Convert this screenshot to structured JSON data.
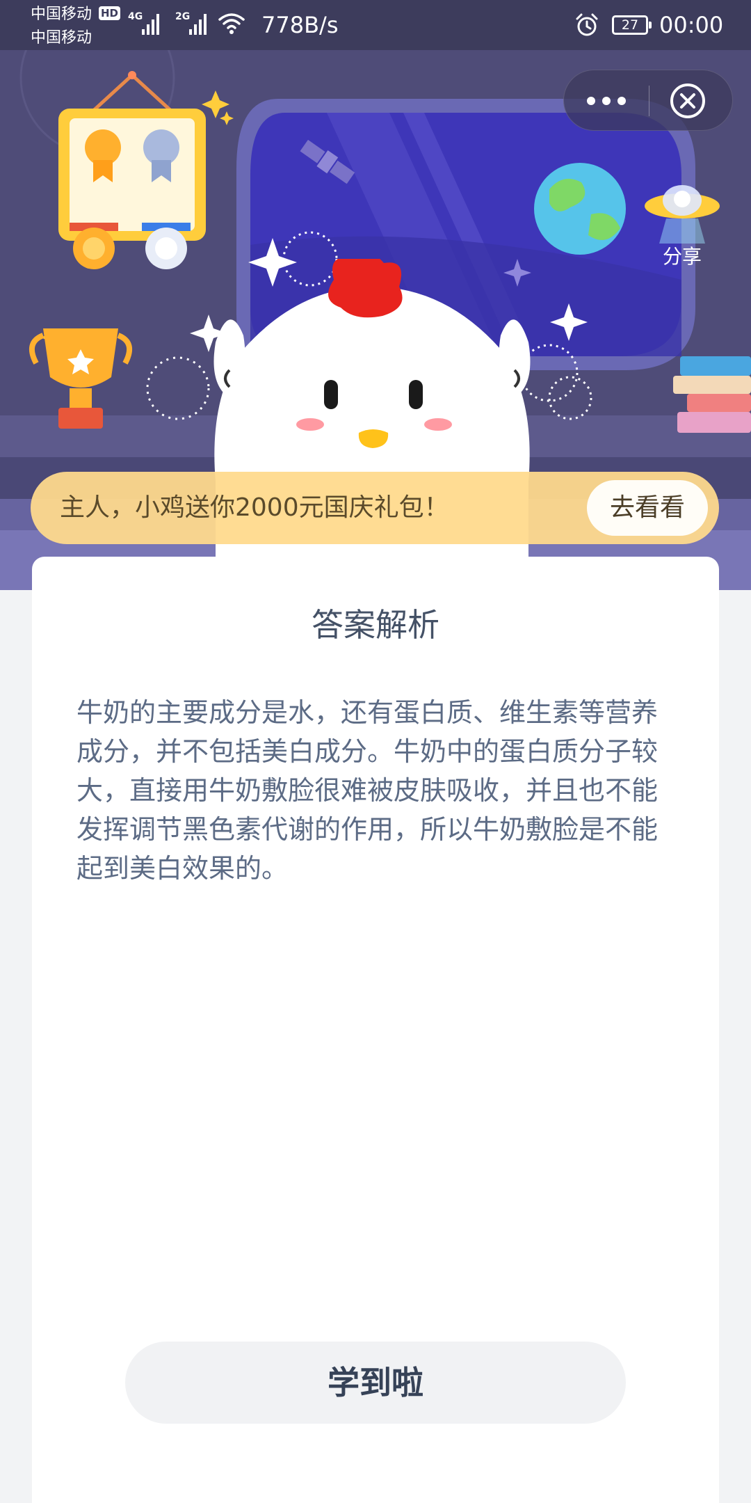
{
  "status_bar": {
    "carrier_primary": "中国移动",
    "hd_badge": "HD",
    "carrier_secondary": "中国移动",
    "network_1": "4G",
    "network_2": "2G",
    "speed": "778B/s",
    "battery": "27",
    "time": "00:00"
  },
  "capsule": {
    "more_icon": "more-dots-icon",
    "close_icon": "close-circle-icon"
  },
  "hero": {
    "share_label": "分享",
    "colors": {
      "sky": "#4f4c78",
      "window": "#3e36b8",
      "banner": "#ffd98c"
    }
  },
  "promo": {
    "text": "主人，小鸡送你2000元国庆礼包！",
    "button": "去看看"
  },
  "card": {
    "title": "答案解析",
    "body": "牛奶的主要成分是水，还有蛋白质、维生素等营养成分，并不包括美白成分。牛奶中的蛋白质分子较大，直接用牛奶敷脸很难被皮肤吸收，并且也不能发挥调节黑色素代谢的作用，所以牛奶敷脸是不能起到美白效果的。",
    "button": "学到啦"
  }
}
